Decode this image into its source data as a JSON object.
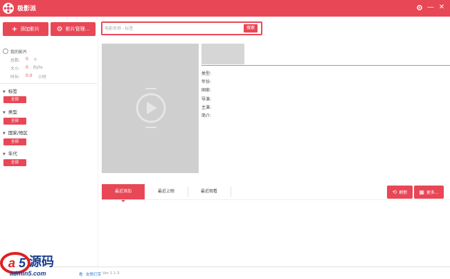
{
  "app": {
    "title": "极影派"
  },
  "window": {
    "settings_icon": "gear-icon",
    "minimize_icon": "minimize-icon",
    "close_icon": "close-icon"
  },
  "toolbar": {
    "add_label": "添加影片",
    "manage_label": "影片管理..."
  },
  "search": {
    "placeholder": "电影名称 - 标签",
    "button": "搜索"
  },
  "stats": {
    "title": "我的影片",
    "rows": [
      {
        "label": "总数:",
        "value": "0",
        "unit": "个"
      },
      {
        "label": "大小:",
        "value": "0",
        "unit": "Byte"
      },
      {
        "label": "时长:",
        "value": "0.0",
        "unit": "小时"
      }
    ]
  },
  "filters": [
    {
      "title": "标签",
      "chip": "全部"
    },
    {
      "title": "类型",
      "chip": "全部"
    },
    {
      "title": "国家/地区",
      "chip": "全部"
    },
    {
      "title": "年代",
      "chip": "全部"
    }
  ],
  "details": {
    "labels": [
      "类型:",
      "年份:",
      "国家:",
      "导演:",
      "主演:",
      "简介:"
    ]
  },
  "tabs": [
    {
      "label": "最近添加",
      "active": true
    },
    {
      "label": "最近上映",
      "active": false
    },
    {
      "label": "最近观看",
      "active": false
    }
  ],
  "actions": {
    "refresh": "刷新",
    "more": "更多..."
  },
  "footer": {
    "link_partial": "看",
    "friend_link": "友情打赏",
    "version": "Ver 1.1.5"
  },
  "watermark": {
    "text": "admin5.com",
    "brand": "a5源码"
  },
  "colors": {
    "accent": "#e84756",
    "link": "#3b7ed0"
  }
}
